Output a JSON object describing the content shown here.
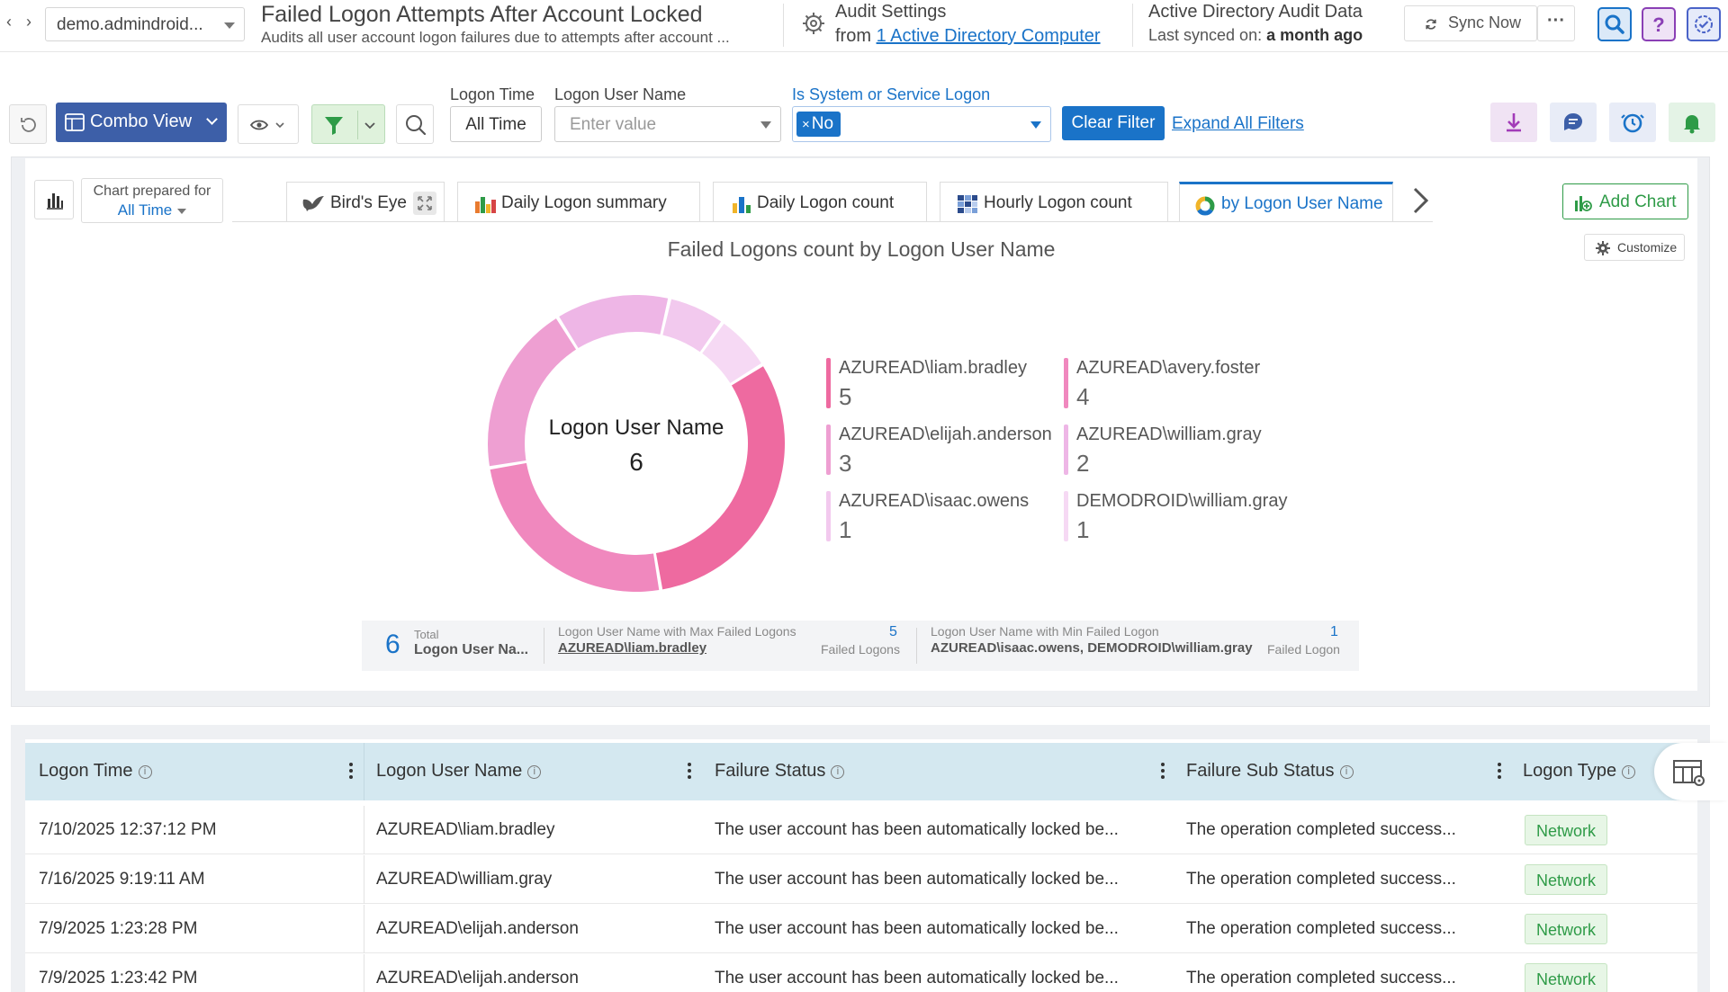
{
  "header": {
    "tenant": "demo.admindroid...",
    "report_title": "Failed Logon Attempts After Account Locked",
    "report_desc": "Audits all user account logon failures due to attempts after account ...",
    "audit_title": "Audit Settings",
    "audit_from_prefix": "from",
    "audit_from_link": "1 Active Directory Computer",
    "ad_title": "Active Directory Audit Data",
    "ad_last_synced_label": "Last synced on:",
    "ad_last_synced_value": "a month ago",
    "sync_now": "Sync Now",
    "more": "···"
  },
  "filters": {
    "view_label": "Combo View",
    "logon_time_label": "Logon Time",
    "logon_time_value": "All Time",
    "user_label": "Logon User Name",
    "user_placeholder": "Enter value",
    "system_label": "Is System or Service Logon",
    "system_chip_x": "×",
    "system_chip": "No",
    "clear_filter": "Clear Filter",
    "expand_all": "Expand All Filters"
  },
  "chart_panel": {
    "prepared_for_label": "Chart prepared for",
    "prepared_for_value": "All Time",
    "tabs": [
      {
        "label": "Bird's Eye"
      },
      {
        "label": "Daily Logon summary"
      },
      {
        "label": "Daily Logon count"
      },
      {
        "label": "Hourly Logon count"
      },
      {
        "label": "by Logon User Name"
      }
    ],
    "add_chart": "Add Chart",
    "customize": "Customize"
  },
  "chart_data": {
    "type": "pie",
    "title": "Failed Logons count by Logon User Name",
    "center_label": "Logon User Name",
    "center_value": "6",
    "categories": [
      "AZUREAD\\liam.bradley",
      "AZUREAD\\avery.foster",
      "AZUREAD\\elijah.anderson",
      "AZUREAD\\william.gray",
      "AZUREAD\\isaac.owens",
      "DEMODROID\\william.gray"
    ],
    "values": [
      5,
      4,
      3,
      2,
      1,
      1
    ],
    "colors": [
      "#ee6aa0",
      "#f088be",
      "#ee9fd2",
      "#eeb6e6",
      "#f2c9ee",
      "#f6d9f4"
    ],
    "legend_placement": "right"
  },
  "summary": {
    "total_num": "6",
    "total_label": "Total",
    "total_text": "Logon User Na...",
    "max_label": "Logon User Name with Max Failed Logons",
    "max_name": "AZUREAD\\liam.bradley",
    "max_num": "5",
    "max_unit": "Failed Logons",
    "min_label": "Logon User Name with Min Failed Logon",
    "min_name": "AZUREAD\\isaac.owens, DEMODROID\\william.gray",
    "min_num": "1",
    "min_unit": "Failed Logon"
  },
  "table": {
    "columns": [
      "Logon Time",
      "Logon User Name",
      "Failure Status",
      "Failure Sub Status",
      "Logon Type"
    ],
    "info_glyph": "i",
    "rows": [
      [
        "7/10/2025 12:37:12 PM",
        "AZUREAD\\liam.bradley",
        "The user account has been automatically locked be...",
        "The operation completed success...",
        "Network"
      ],
      [
        "7/16/2025 9:19:11 AM",
        "AZUREAD\\william.gray",
        "The user account has been automatically locked be...",
        "The operation completed success...",
        "Network"
      ],
      [
        "7/9/2025 1:23:28 PM",
        "AZUREAD\\elijah.anderson",
        "The user account has been automatically locked be...",
        "The operation completed success...",
        "Network"
      ],
      [
        "7/9/2025 1:23:42 PM",
        "AZUREAD\\elijah.anderson",
        "The user account has been automatically locked be...",
        "The operation completed success...",
        "Network"
      ]
    ]
  }
}
